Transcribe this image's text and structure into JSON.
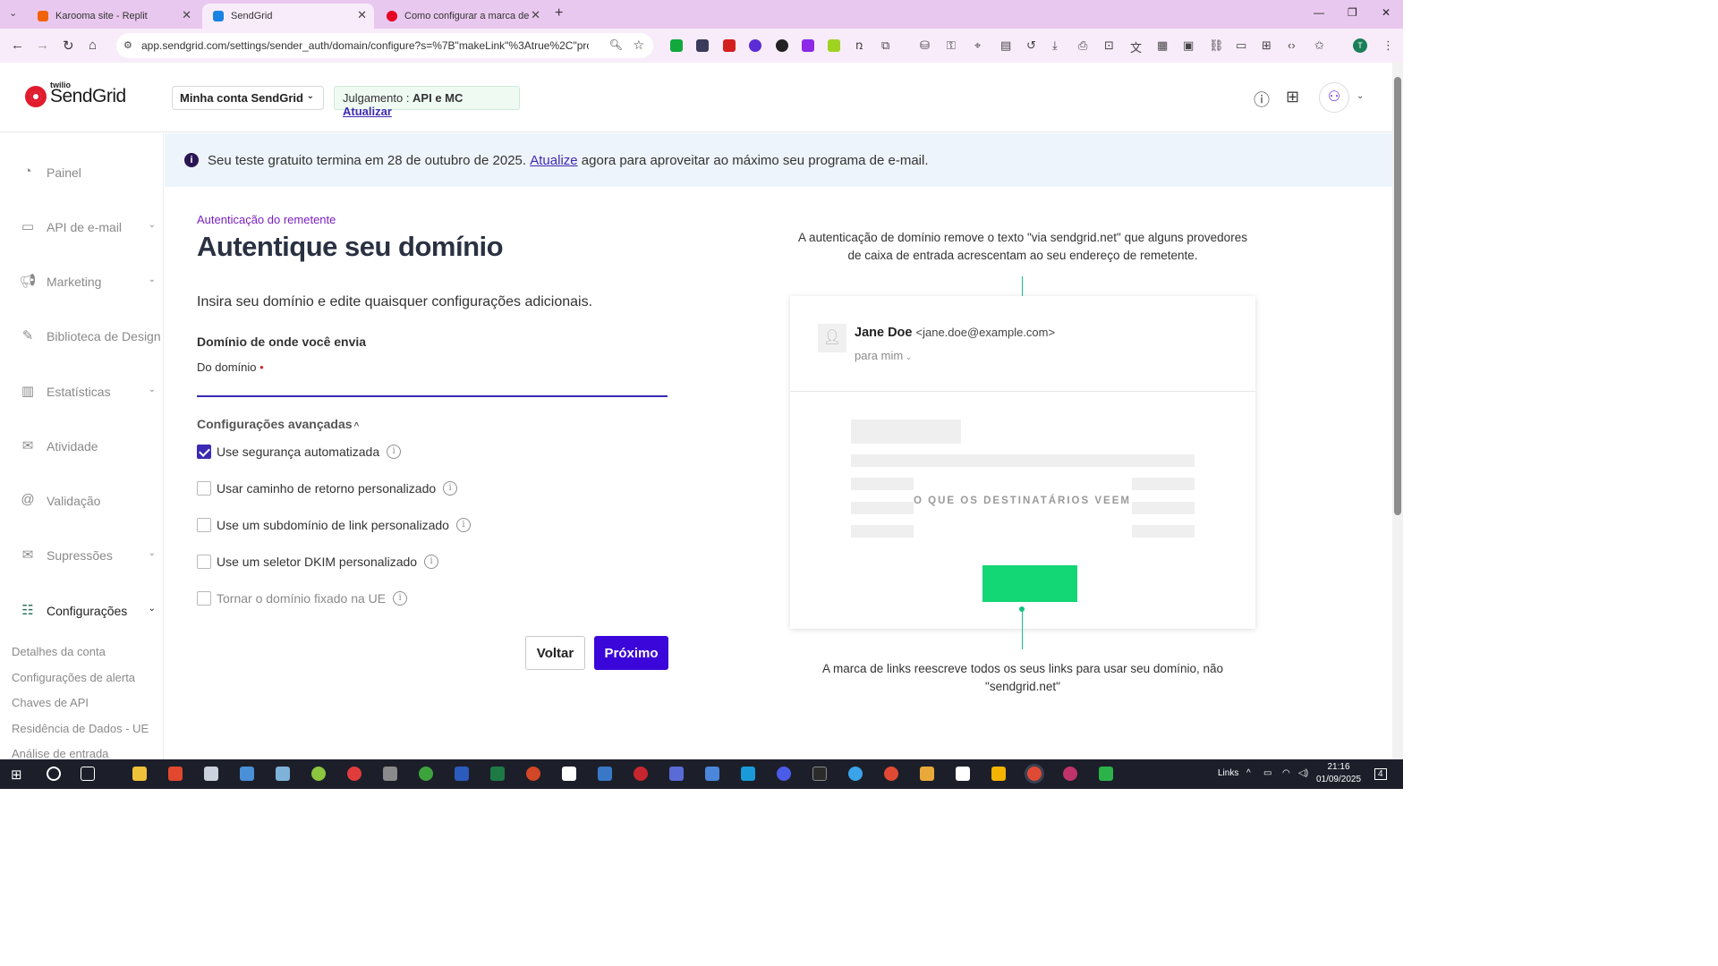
{
  "browser": {
    "tabs": [
      {
        "title": "Karooma site - Replit",
        "favicon_color": "#f26207"
      },
      {
        "title": "SendGrid",
        "favicon_color": "#1a82e2"
      },
      {
        "title": "Como configurar a marca de lin",
        "favicon_color": "#e60023"
      }
    ],
    "url": "app.sendgrid.com/settings/sender_auth/domain/configure?s=%7B\"makeLink\"%3Atrue%2C\"provider...",
    "profile_initial": "T"
  },
  "header": {
    "logo_small": "twilio",
    "logo_text": "SendGrid",
    "account_selector": "Minha conta SendGrid",
    "trial_label": "Julgamento : ",
    "trial_plan": "API e MC",
    "trial_upgrade": "Atualizar"
  },
  "sidebar": {
    "items": [
      {
        "label": "Painel",
        "icon": "gauge-icon"
      },
      {
        "label": "API de e-mail",
        "icon": "code-window-icon"
      },
      {
        "label": "Marketing",
        "icon": "megaphone-icon"
      },
      {
        "label": "Biblioteca de Design",
        "icon": "pencil-ruler-icon"
      },
      {
        "label": "Estatísticas",
        "icon": "bar-chart-icon"
      },
      {
        "label": "Atividade",
        "icon": "envelope-icon"
      },
      {
        "label": "Validação",
        "icon": "at-check-icon"
      },
      {
        "label": "Supressões",
        "icon": "envelope-blocked-icon"
      },
      {
        "label": "Configurações",
        "icon": "sliders-icon"
      }
    ],
    "subitems": [
      "Detalhes da conta",
      "Configurações de alerta",
      "Chaves de API",
      "Residência de Dados - UE",
      "Análise de entrada"
    ]
  },
  "banner": {
    "text_before": "Seu teste gratuito termina em 28 de outubro de 2025.",
    "link": "Atualize",
    "text_after": "agora para aproveitar ao máximo seu programa de e-mail."
  },
  "main": {
    "eyebrow": "Autenticação do remetente",
    "title": "Autentique seu domínio",
    "lede": "Insira seu domínio e edite quaisquer configurações adicionais.",
    "section_title": "Domínio de onde você envia",
    "field_label": "Do domínio",
    "required_mark": "•",
    "domain_value": "",
    "advanced_title": "Configurações avançadas",
    "options": [
      {
        "label": "Use segurança automatizada",
        "checked": true,
        "disabled": false
      },
      {
        "label": "Usar caminho de retorno personalizado",
        "checked": false,
        "disabled": false
      },
      {
        "label": "Use um subdomínio de link personalizado",
        "checked": false,
        "disabled": false
      },
      {
        "label": "Use um seletor DKIM personalizado",
        "checked": false,
        "disabled": false
      },
      {
        "label": "Tornar o domínio fixado na UE",
        "checked": false,
        "disabled": true
      }
    ],
    "back_label": "Voltar",
    "next_label": "Próximo"
  },
  "illustration": {
    "top_text": "A autenticação de domínio remove o texto \"via sendgrid.net\" que alguns provedores de caixa de entrada acrescentam ao seu endereço de remetente.",
    "sender_name": "Jane Doe",
    "sender_email": "<jane.doe@example.com>",
    "to_line": "para mim",
    "recipients_text": "O QUE OS DESTINATÁRIOS VEEM",
    "bottom_text": "A marca de links reescreve todos os seus links para usar seu domínio, não \"sendgrid.net\""
  },
  "taskbar": {
    "links_label": "Links",
    "time": "21:16",
    "date": "01/09/2025",
    "notifications": "4"
  },
  "colors": {
    "accent": "#3a06d9",
    "link": "#3f2ab3",
    "green": "#13d674",
    "tab_strip": "#e9c8ef"
  }
}
